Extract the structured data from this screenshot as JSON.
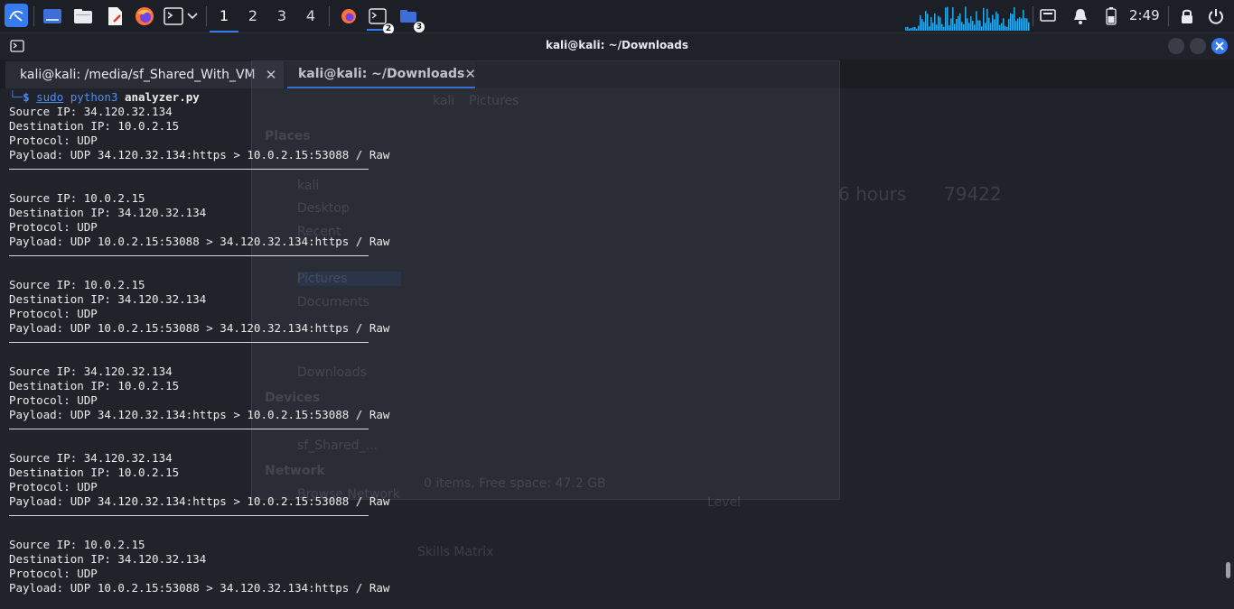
{
  "taskbar": {
    "workspaces": [
      "1",
      "2",
      "3",
      "4"
    ],
    "active_workspace": "1",
    "terminal_badge": "2",
    "files_badge": "3",
    "clock": "2:49"
  },
  "window": {
    "title": "kali@kali: ~/Downloads",
    "tabs": [
      {
        "label": "kali@kali: /media/sf_Shared_With_VM",
        "active": false
      },
      {
        "label": "kali@kali: ~/Downloads",
        "active": true
      }
    ]
  },
  "terminal": {
    "prompt_corner": "└─",
    "prompt_symbol": "$",
    "command_sudo": "sudo",
    "command_python": "python3",
    "command_script": "analyzer.py",
    "packets": [
      {
        "source": "Source IP: 34.120.32.134",
        "destination": "Destination IP: 10.0.2.15",
        "protocol": "Protocol: UDP",
        "payload": "Payload: UDP 34.120.32.134:https > 10.0.2.15:53088 / Raw"
      },
      {
        "source": "Source IP: 10.0.2.15",
        "destination": "Destination IP: 34.120.32.134",
        "protocol": "Protocol: UDP",
        "payload": "Payload: UDP 10.0.2.15:53088 > 34.120.32.134:https / Raw"
      },
      {
        "source": "Source IP: 10.0.2.15",
        "destination": "Destination IP: 34.120.32.134",
        "protocol": "Protocol: UDP",
        "payload": "Payload: UDP 10.0.2.15:53088 > 34.120.32.134:https / Raw"
      },
      {
        "source": "Source IP: 34.120.32.134",
        "destination": "Destination IP: 10.0.2.15",
        "protocol": "Protocol: UDP",
        "payload": "Payload: UDP 34.120.32.134:https > 10.0.2.15:53088 / Raw"
      },
      {
        "source": "Source IP: 34.120.32.134",
        "destination": "Destination IP: 10.0.2.15",
        "protocol": "Protocol: UDP",
        "payload": "Payload: UDP 34.120.32.134:https > 10.0.2.15:53088 / Raw"
      },
      {
        "source": "Source IP: 10.0.2.15",
        "destination": "Destination IP: 34.120.32.134",
        "protocol": "Protocol: UDP",
        "payload": "Payload: UDP 10.0.2.15:53088 > 34.120.32.134:https / Raw"
      }
    ]
  },
  "background_window": {
    "places_heading": "Places",
    "places": [
      "kali",
      "Desktop",
      "Recent",
      "Pictures",
      "Documents",
      "Downloads"
    ],
    "devices_heading": "Devices",
    "device": "sf_Shared_...",
    "network_heading": "Network",
    "network_item": "Browse Network",
    "path_home": "kali",
    "path_current": "Pictures",
    "status": "0 items, Free space: 47.2 GB",
    "stat_hours": "6 hours",
    "stat_rank": "79422",
    "level_label": "Level",
    "skills_label": "Skills Matrix"
  },
  "colors": {
    "accent": "#367bf0",
    "prompt": "#4f8df7",
    "terminal_bg": "#21232c",
    "text": "#ececec"
  }
}
